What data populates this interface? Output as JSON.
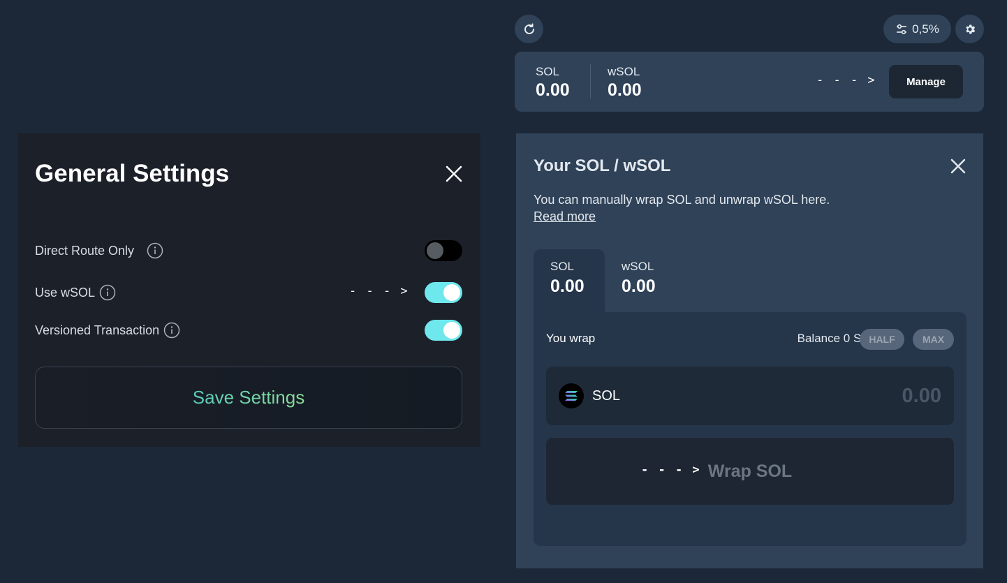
{
  "topbar": {
    "refresh_icon": "refresh-icon",
    "slippage_icon": "sliders-icon",
    "slippage": "0,5%",
    "gear_icon": "gear-icon"
  },
  "balances": {
    "sol_label": "SOL",
    "sol_value": "0.00",
    "wsol_label": "wSOL",
    "wsol_value": "0.00",
    "manage_label": "Manage"
  },
  "annotation_arrow": "- - - >",
  "settings": {
    "title": "General Settings",
    "rows": [
      {
        "label": "Direct Route Only",
        "enabled": false
      },
      {
        "label": "Use wSOL",
        "enabled": true
      },
      {
        "label": "Versioned Transaction",
        "enabled": true
      }
    ],
    "save_label": "Save Settings"
  },
  "wrap": {
    "title": "Your SOL / wSOL",
    "description": "You can manually wrap SOL and unwrap wSOL here.",
    "read_more": "Read more",
    "tabs": [
      {
        "label": "SOL",
        "value": "0.00"
      },
      {
        "label": "wSOL",
        "value": "0.00"
      }
    ],
    "you_wrap": "You wrap",
    "balance_text": "Balance 0 SOL",
    "half": "HALF",
    "max": "MAX",
    "token": "SOL",
    "amount_placeholder": "0.00",
    "button_label": "Wrap SOL"
  },
  "colors": {
    "background": "#1c2838",
    "panel": "#2f4258",
    "settings_panel": "#1c2029",
    "toggle_on": "#6ee7ed",
    "save_gradient_start": "#58cdb9",
    "save_gradient_end": "#8bde9a"
  }
}
